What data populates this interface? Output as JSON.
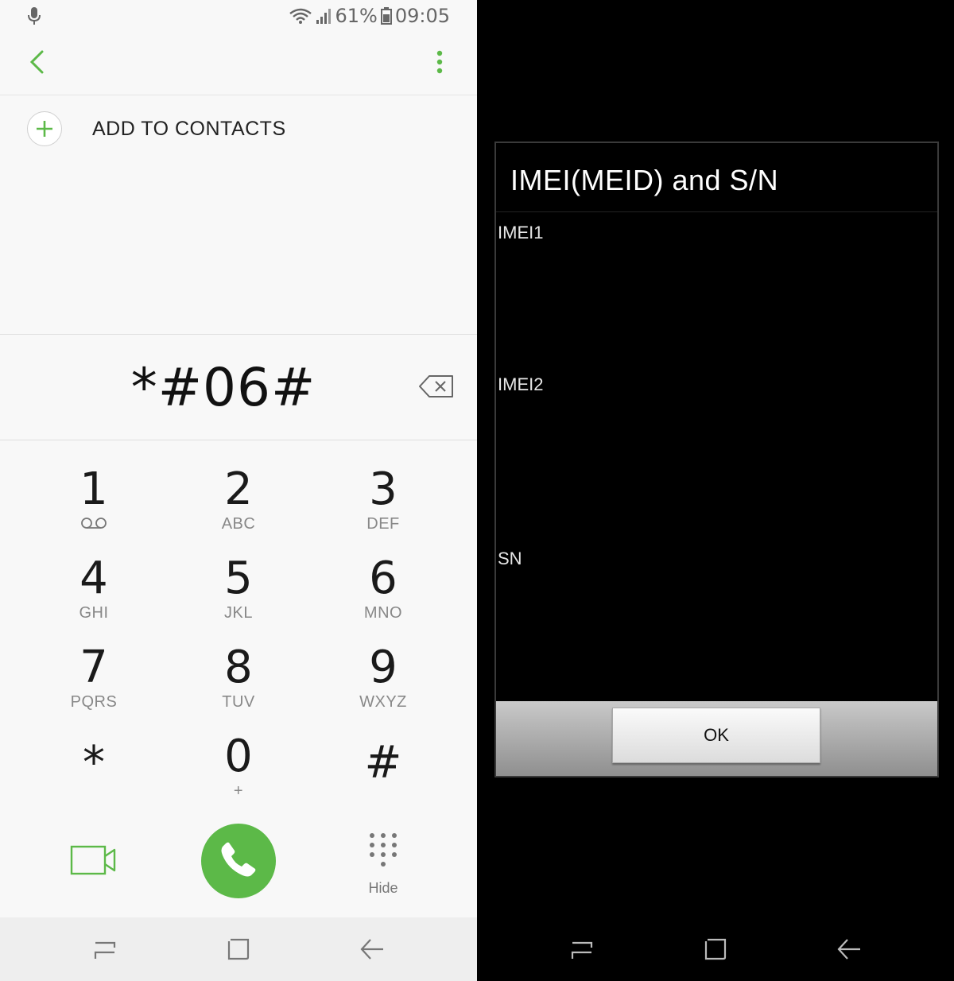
{
  "status_bar": {
    "battery": "61%",
    "time": "09:05"
  },
  "dialer": {
    "add_to_contacts": "ADD TO CONTACTS",
    "number": "*#06#",
    "keys": [
      {
        "digit": "1",
        "letters": ""
      },
      {
        "digit": "2",
        "letters": "ABC"
      },
      {
        "digit": "3",
        "letters": "DEF"
      },
      {
        "digit": "4",
        "letters": "GHI"
      },
      {
        "digit": "5",
        "letters": "JKL"
      },
      {
        "digit": "6",
        "letters": "MNO"
      },
      {
        "digit": "7",
        "letters": "PQRS"
      },
      {
        "digit": "8",
        "letters": "TUV"
      },
      {
        "digit": "9",
        "letters": "WXYZ"
      },
      {
        "digit": "*",
        "letters": ""
      },
      {
        "digit": "0",
        "letters": "+"
      },
      {
        "digit": "#",
        "letters": ""
      }
    ],
    "hide_label": "Hide",
    "accent_color": "#5cb948"
  },
  "imei_dialog": {
    "title": "IMEI(MEID) and S/N",
    "rows": [
      "IMEI1",
      "IMEI2",
      "SN"
    ],
    "ok_label": "OK"
  },
  "icons": [
    "microphone-icon",
    "wifi-icon",
    "signal-icon",
    "battery-icon",
    "back-arrow-icon",
    "more-vert-icon",
    "add-icon",
    "backspace-icon",
    "voicemail-icon",
    "video-call-icon",
    "phone-icon",
    "dialpad-icon",
    "recent-apps-icon",
    "home-icon",
    "nav-back-icon"
  ]
}
